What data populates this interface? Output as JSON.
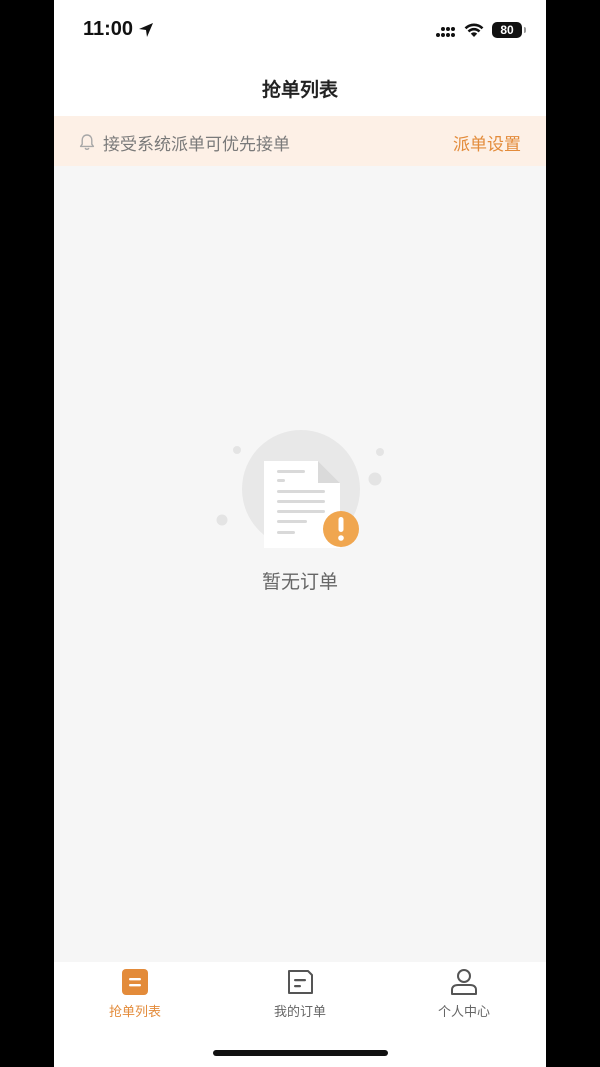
{
  "status_bar": {
    "time": "11:00",
    "battery": "80",
    "icons": [
      "location-arrow-icon",
      "signal-icon",
      "wifi-icon",
      "battery-icon"
    ]
  },
  "header": {
    "title": "抢单列表"
  },
  "notice": {
    "icon": "bell-icon",
    "text": "接受系统派单可优先接单",
    "action_label": "派单设置"
  },
  "empty_state": {
    "icon": "empty-document-warning-icon",
    "text": "暂无订单"
  },
  "tab_bar": {
    "tabs": [
      {
        "label": "抢单列表",
        "icon": "order-list-icon",
        "active": true
      },
      {
        "label": "我的订单",
        "icon": "my-orders-icon",
        "active": false
      },
      {
        "label": "个人中心",
        "icon": "profile-icon",
        "active": false
      }
    ]
  },
  "colors": {
    "accent": "#e38b3a",
    "notice_bg": "#fdf0e6",
    "page_bg": "#f6f6f6"
  }
}
